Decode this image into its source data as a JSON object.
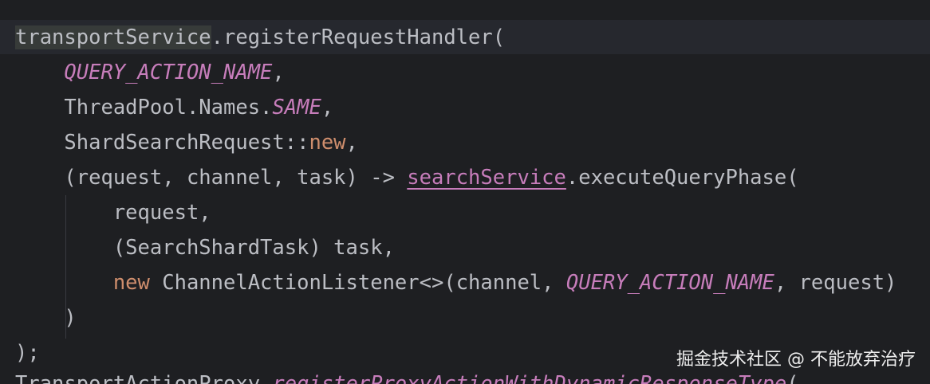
{
  "colors": {
    "background": "#1e1f22",
    "current_line": "#26282e",
    "default_text": "#bcbec4",
    "constant": "#c77dbb",
    "keyword": "#cf8e6d"
  },
  "code": {
    "line1": {
      "receiver": "transportService",
      "rest": ".registerRequestHandler("
    },
    "line2": {
      "constant": "QUERY_ACTION_NAME",
      "suffix": ","
    },
    "line3": {
      "prefix": "ThreadPool.Names.",
      "constant": "SAME",
      "suffix": ","
    },
    "line4": {
      "prefix": "ShardSearchRequest::",
      "keyword": "new",
      "suffix": ","
    },
    "line5": {
      "prefix": "(request, channel, task) -> ",
      "field": "searchService",
      "suffix": ".executeQueryPhase("
    },
    "line6": {
      "text": "request,"
    },
    "line7": {
      "text": "(SearchShardTask) task,"
    },
    "line8": {
      "keyword": "new",
      "middle": " ChannelActionListener<>(channel, ",
      "constant": "QUERY_ACTION_NAME",
      "suffix": ", request)"
    },
    "line9": {
      "text": ")"
    },
    "line10": {
      "text": ");"
    },
    "line11": {
      "prefix": "TransportActionProxy.",
      "method": "registerProxyActionWithDynamicResponseType",
      "suffix": "("
    }
  },
  "watermark": {
    "text": "掘金技术社区 @ 不能放弃治疗"
  }
}
